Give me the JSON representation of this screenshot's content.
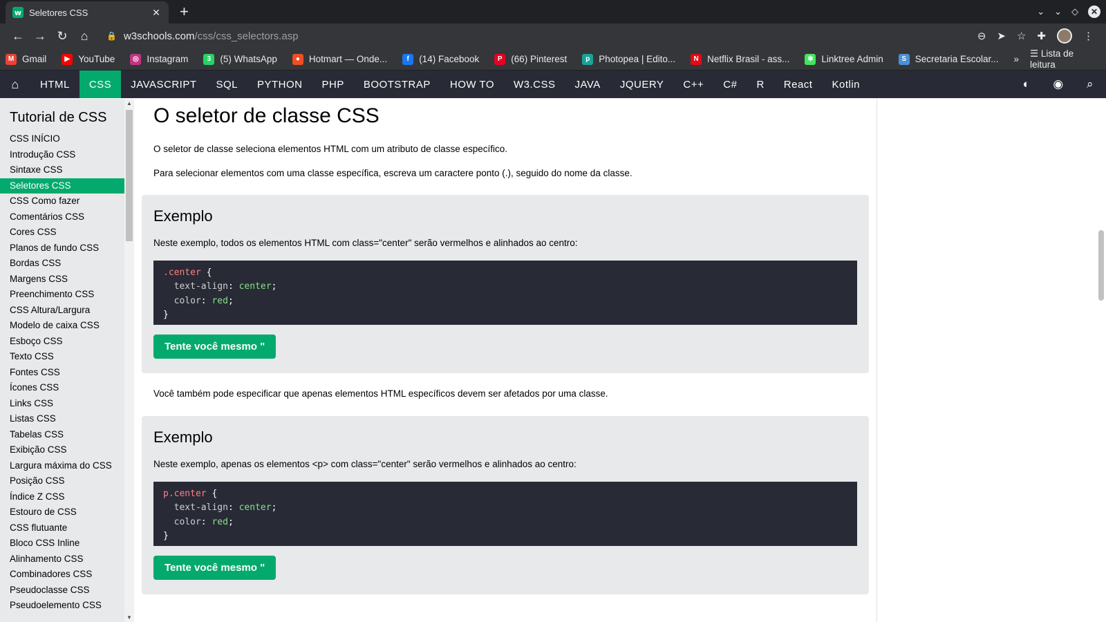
{
  "browser": {
    "tab_title": "Seletores CSS",
    "tab_favicon": "w",
    "url_host": "w3schools.com",
    "url_path": "/css/css_selectors.asp",
    "bookmarks": [
      {
        "label": "Gmail",
        "color": "#ea4335",
        "icon": "M"
      },
      {
        "label": "YouTube",
        "color": "#ff0000",
        "icon": "▶"
      },
      {
        "label": "Instagram",
        "color": "#c13584",
        "icon": "◎"
      },
      {
        "label": "(5) WhatsApp",
        "color": "#25d366",
        "icon": "3"
      },
      {
        "label": "Hotmart — Onde...",
        "color": "#f04e23",
        "icon": "●"
      },
      {
        "label": "(14) Facebook",
        "color": "#1877f2",
        "icon": "f"
      },
      {
        "label": "(66) Pinterest",
        "color": "#e60023",
        "icon": "P"
      },
      {
        "label": "Photopea | Edito...",
        "color": "#18a497",
        "icon": "p"
      },
      {
        "label": "Netflix Brasil - ass...",
        "color": "#e50914",
        "icon": "N"
      },
      {
        "label": "Linktree Admin",
        "color": "#43e55e",
        "icon": "✱"
      },
      {
        "label": "Secretaria Escolar...",
        "color": "#4a90d9",
        "icon": "S"
      }
    ],
    "reading_list": "Lista de leitura"
  },
  "topnav": {
    "items": [
      "HTML",
      "CSS",
      "JAVASCRIPT",
      "SQL",
      "PYTHON",
      "PHP",
      "BOOTSTRAP",
      "HOW TO",
      "W3.CSS",
      "JAVA",
      "JQUERY",
      "C++",
      "C#",
      "R",
      "React",
      "Kotlin"
    ],
    "active": "CSS",
    "accent": "#04aa6d"
  },
  "sidebar": {
    "title": "Tutorial de CSS",
    "items": [
      "CSS INÍCIO",
      "Introdução CSS",
      "Sintaxe CSS",
      "Seletores CSS",
      "CSS Como fazer",
      "Comentários CSS",
      "Cores CSS",
      "Planos de fundo CSS",
      "Bordas CSS",
      "Margens CSS",
      "Preenchimento CSS",
      "CSS Altura/Largura",
      "Modelo de caixa CSS",
      "Esboço CSS",
      "Texto CSS",
      "Fontes CSS",
      "Ícones CSS",
      "Links CSS",
      "Listas CSS",
      "Tabelas CSS",
      "Exibição CSS",
      "Largura máxima do CSS",
      "Posição CSS",
      "Índice Z CSS",
      "Estouro de CSS",
      "CSS flutuante",
      "Bloco CSS Inline",
      "Alinhamento CSS",
      "Combinadores CSS",
      "Pseudoclasse CSS",
      "Pseudoelemento CSS"
    ],
    "active": "Seletores CSS"
  },
  "content": {
    "heading": "O seletor de classe CSS",
    "p1": "O seletor de classe seleciona elementos HTML com um atributo de classe específico.",
    "p2": "Para selecionar elementos com uma classe específica, escreva um caractere ponto (.), seguido do nome da classe.",
    "p3": "Você também pode especificar que apenas elementos HTML específicos devem ser afetados por uma classe.",
    "example1": {
      "title": "Exemplo",
      "desc": "Neste exemplo, todos os elementos HTML com class=\"center\" serão vermelhos e alinhados ao centro:",
      "selector": ".center",
      "prop1": "text-align",
      "val1": "center",
      "prop2": "color",
      "val2": "red",
      "button": "Tente você mesmo \""
    },
    "example2": {
      "title": "Exemplo",
      "desc": "Neste exemplo, apenas os elementos <p> com class=\"center\" serão vermelhos e alinhados ao centro:",
      "selector": "p.center",
      "prop1": "text-align",
      "val1": "center",
      "prop2": "color",
      "val2": "red",
      "button": "Tente você mesmo \""
    }
  }
}
